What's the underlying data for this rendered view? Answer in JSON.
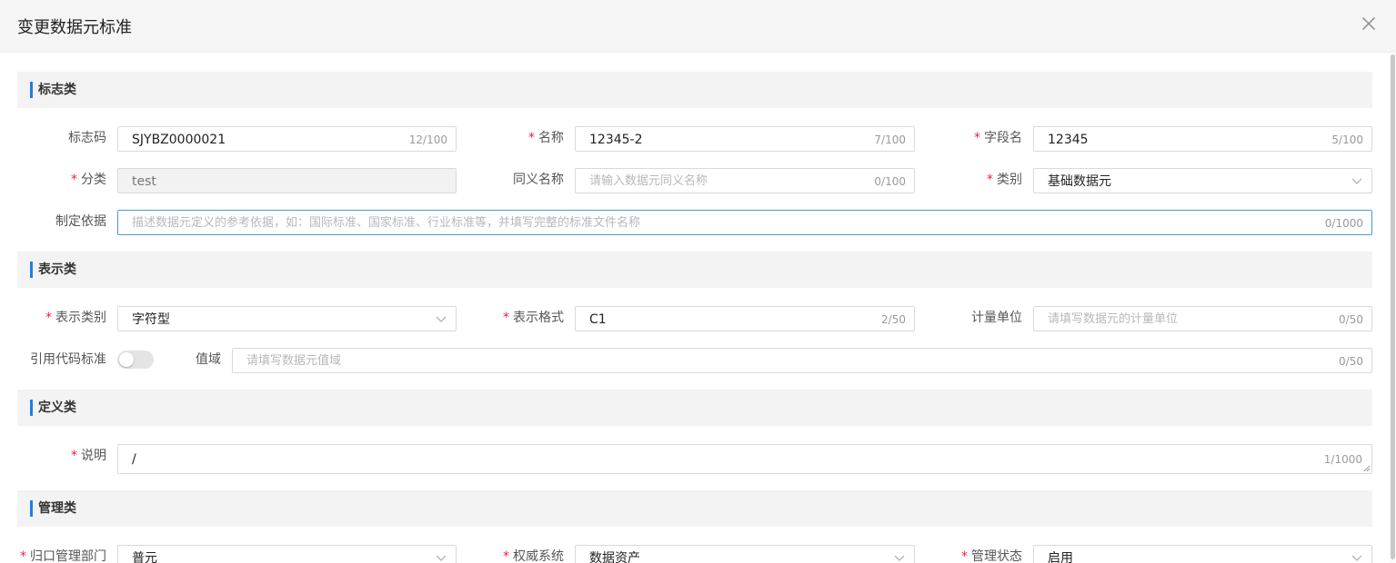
{
  "dialog": {
    "title": "变更数据元标准"
  },
  "sections": {
    "biaozhi": {
      "title": "标志类"
    },
    "biaoshi": {
      "title": "表示类"
    },
    "dingyi": {
      "title": "定义类"
    },
    "guanli": {
      "title": "管理类"
    }
  },
  "fields": {
    "biaozhima": {
      "label": "标志码",
      "value": "SJYBZ0000021",
      "count": "12/100"
    },
    "mingcheng": {
      "label": "名称",
      "value": "12345-2",
      "count": "7/100"
    },
    "ziduanming": {
      "label": "字段名",
      "value": "12345",
      "count": "5/100"
    },
    "fenlei": {
      "label": "分类",
      "value": "test"
    },
    "tongyi": {
      "label": "同义名称",
      "placeholder": "请输入数据元同义名称",
      "count": "0/100"
    },
    "leibie": {
      "label": "类别",
      "value": "基础数据元"
    },
    "zhiding": {
      "label": "制定依据",
      "placeholder": "描述数据元定义的参考依据，如：国际标准、国家标准、行业标准等，并填写完整的标准文件名称",
      "count": "0/1000"
    },
    "biaoshileibie": {
      "label": "表示类别",
      "value": "字符型"
    },
    "biaoshigeshi": {
      "label": "表示格式",
      "value": "C1",
      "count": "2/50"
    },
    "jiliangdanwei": {
      "label": "计量单位",
      "placeholder": "请填写数据元的计量单位",
      "count": "0/50"
    },
    "yinyong": {
      "label": "引用代码标准",
      "enabled": false
    },
    "zhiyu": {
      "label": "值域",
      "placeholder": "请填写数据元值域",
      "count": "0/50"
    },
    "shuoming": {
      "label": "说明",
      "value": "/",
      "count": "1/1000"
    },
    "guikou": {
      "label": "归口管理部门",
      "value": "普元"
    },
    "quanwei": {
      "label": "权威系统",
      "value": "数据资产"
    },
    "guanlizhuangtai": {
      "label": "管理状态",
      "value": "启用"
    }
  },
  "colors": {
    "accent": "#1e7fe6",
    "required": "#f5222d",
    "focus_border": "#4a9bd8"
  }
}
